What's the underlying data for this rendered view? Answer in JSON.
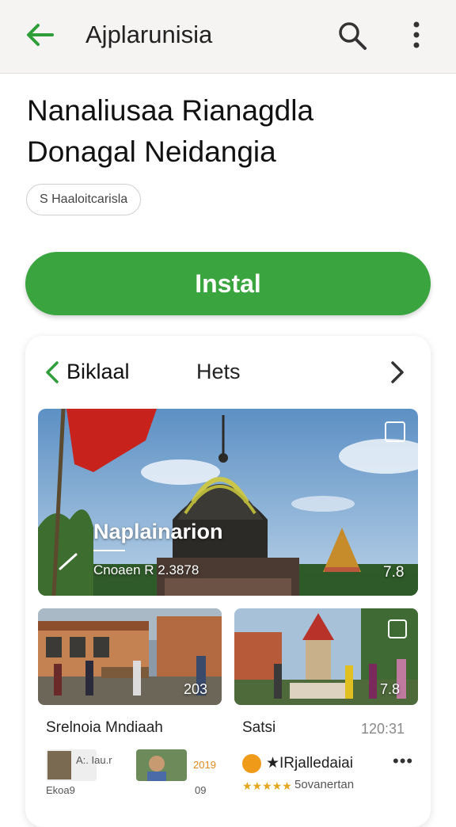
{
  "appbar": {
    "title": "Ajplarunisia",
    "back_icon": "arrow-left-icon",
    "search_icon": "search-icon",
    "more_icon": "more-vert-icon",
    "accent": "#2e9d3a"
  },
  "app": {
    "headline_line1": "Nanaliusaa Rianagdla",
    "headline_line2": "Donagal Neidangia",
    "chip_label": "S Haaloitcarisla",
    "install_label": "Instal",
    "install_color": "#3aa53e"
  },
  "gallery": {
    "tabs": [
      "Biklaal",
      "Hets"
    ],
    "hero": {
      "title": "Naplainarion",
      "subtitle": "Cnoaen R 2.3878",
      "number": "7.8"
    },
    "cards": [
      {
        "number": "203",
        "name": "Srelnoia Mndiaah",
        "time": "",
        "thumb_label_a": "A:. Iau.r",
        "thumb_label_b": "Ekoa9",
        "thumb_label_c": "09",
        "thumb_label_d": "2019"
      },
      {
        "number": "7.8",
        "name": "Satsi",
        "time": "120:31",
        "publisher": "★IRjalledaiai",
        "more": "•••",
        "stars": "★★★★★",
        "reviews": "5ovanertan"
      }
    ]
  }
}
